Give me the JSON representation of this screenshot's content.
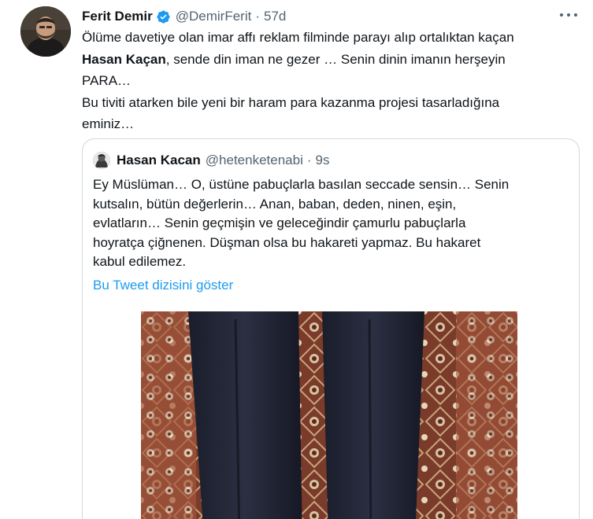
{
  "author": {
    "name": "Ferit Demir",
    "handle": "@DemirFerit",
    "separator": "·",
    "time": "57d"
  },
  "tweet": {
    "line1": "Ölüme davetiye olan imar affı reklam filminde parayı alıp ortalıktan kaçan",
    "line2_bold": "Hasan Kaçan",
    "line2_rest": ", sende din iman ne gezer … Senin dinin imanın herşeyin",
    "line3": "PARA…",
    "line4": "Bu tiviti atarken bile yeni bir haram para kazanma projesi tasarladığına",
    "line5": "eminiz…"
  },
  "quoted": {
    "name": "Hasan Kacan",
    "handle": "@hetenketenabi",
    "separator": "·",
    "time": "9s",
    "lines": [
      "Ey Müslüman… O, üstüne pabuçlarla basılan seccade sensin… Senin",
      "kutsalın, bütün değerlerin… Anan, baban, deden, ninen, eşin,",
      "evlatların… Senin geçmişin ve geleceğindir çamurlu pabuçlarla",
      "hoyratça çiğnenen. Düşman olsa bu hakareti yapmaz. Bu hakaret",
      "kabul edilemez."
    ],
    "show_thread": "Bu Tweet dizisini göster"
  },
  "colors": {
    "text": "#0f1419",
    "secondary": "#536471",
    "link": "#1d9bf0",
    "border": "#cfd9de",
    "verified": "#1d9bf0"
  }
}
